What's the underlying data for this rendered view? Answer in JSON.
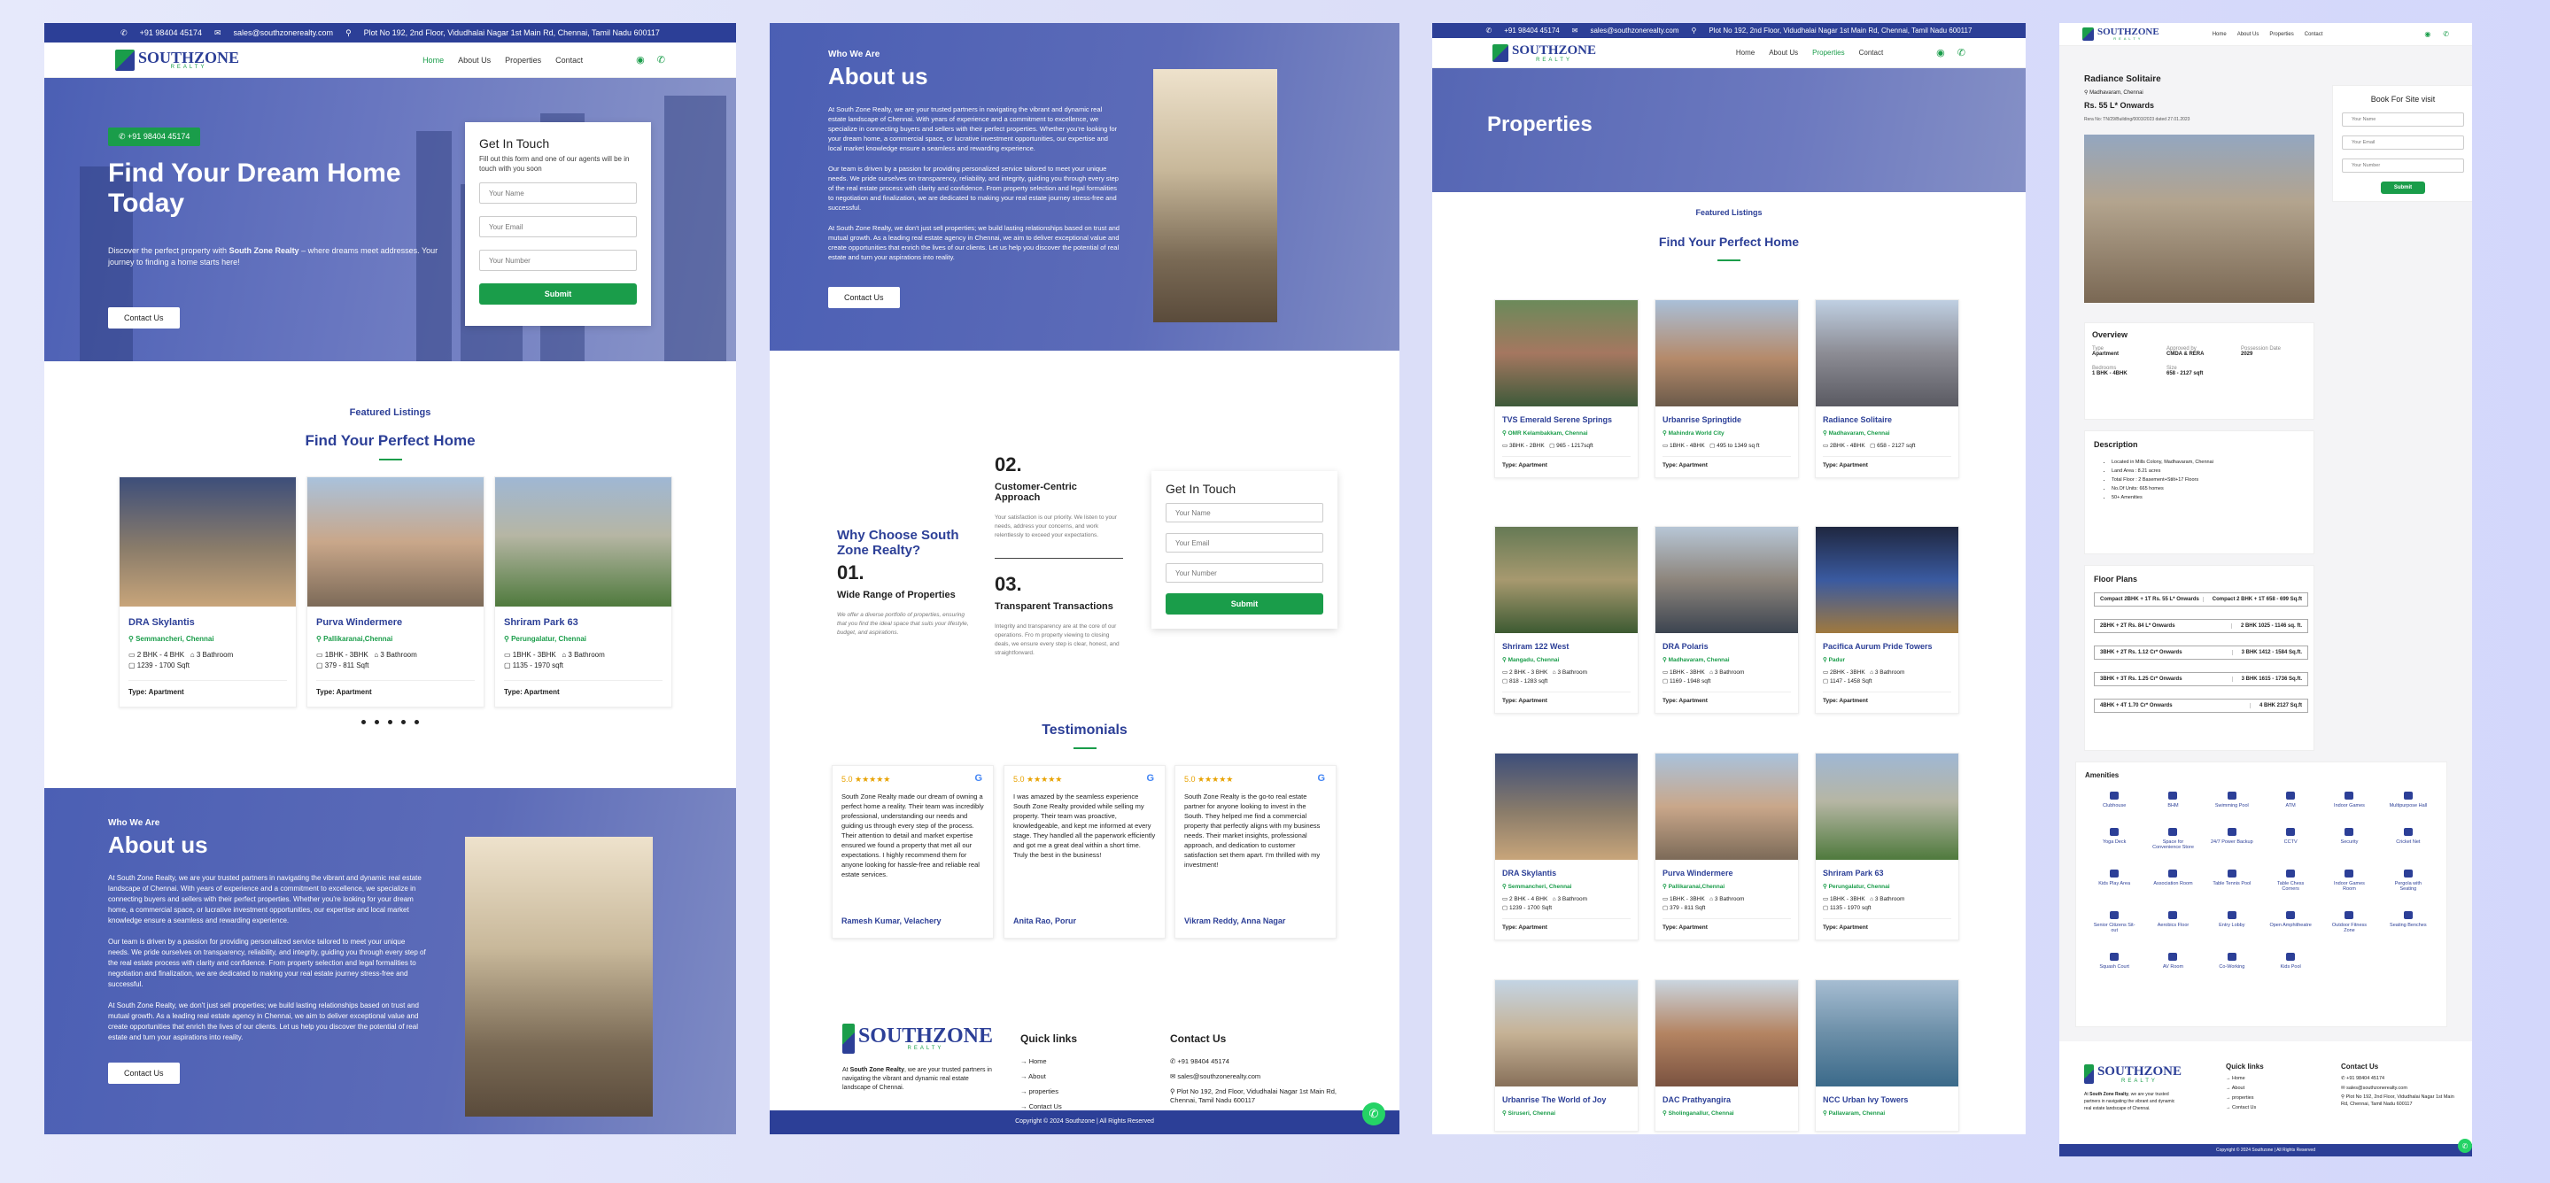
{
  "contact": {
    "phone": "+91 98404 45174",
    "email": "sales@southzonerealty.com",
    "address": "Plot No 192, 2nd Floor, Vidudhalai Nagar 1st Main Rd, Chennai, Tamil Nadu 600117"
  },
  "brand": {
    "name": "SOUTHZONE",
    "sub": "REALTY"
  },
  "nav": {
    "home": "Home",
    "about": "About Us",
    "properties": "Properties",
    "contact": "Contact"
  },
  "hero": {
    "phone_pill": "+91 98404 45174",
    "title": "Find Your Dream Home Today",
    "desc_pre": "Discover the perfect property with ",
    "desc_brand": "South Zone Realty",
    "desc_post": " – where dreams meet addresses. Your journey to finding a home starts here!",
    "cta": "Contact Us"
  },
  "form": {
    "title": "Get In Touch",
    "desc": "Fill out this form and one of our agents will be in touch with you soon",
    "name_ph": "Your Name",
    "email_ph": "Your Email",
    "number_ph": "Your Number",
    "submit": "Submit"
  },
  "featured": {
    "small": "Featured Listings",
    "big": "Find Your Perfect Home"
  },
  "slider": [
    {
      "title": "DRA Skylantis",
      "loc": "Semmancheri, Chennai",
      "bhk": "2 BHK - 4 BHK",
      "bath": "3 Bathroom",
      "size": "1239 - 1700 Sqft",
      "type": "Type: Apartment"
    },
    {
      "title": "Purva Windermere",
      "loc": "Pallikaranai,Chennai",
      "bhk": "1BHK - 3BHK",
      "bath": "3 Bathroom",
      "size": "379 - 811 Sqft",
      "type": "Type: Apartment"
    },
    {
      "title": "Shriram Park 63",
      "loc": "Perungalatur, Chennai",
      "bhk": "1BHK - 3BHK",
      "bath": "3 Bathroom",
      "size": "1135 - 1970 sqft",
      "type": "Type: Apartment"
    }
  ],
  "about": {
    "who": "Who We Are",
    "title": "About us",
    "p1": "At South Zone Realty, we are your trusted partners in navigating the vibrant and dynamic real estate landscape of Chennai. With years of experience and a commitment to excellence, we specialize in connecting buyers and sellers with their perfect properties. Whether you're looking for your dream home, a commercial space, or lucrative investment opportunities, our expertise and local market knowledge ensure a seamless and rewarding experience.",
    "p2": "Our team is driven by a passion for providing personalized service tailored to meet your unique needs. We pride ourselves on transparency, reliability, and integrity, guiding you through every step of the real estate process with clarity and confidence. From property selection and legal formalities to negotiation and finalization, we are dedicated to making your real estate journey stress-free and successful.",
    "p3": "At South Zone Realty, we don't just sell properties; we build lasting relationships based on trust and mutual growth. As a leading real estate agency in Chennai, we aim to deliver exceptional value and create opportunities that enrich the lives of our clients. Let us help you discover the potential of real estate and turn your aspirations into reality.",
    "cta": "Contact Us"
  },
  "why": {
    "title": "Why Choose South Zone Realty?",
    "n1": "01.",
    "h1": "Wide Range of Properties",
    "d1": "We offer a diverse portfolio of properties, ensuring that you find the ideal space that suits your lifestyle, budget, and aspirations.",
    "n2": "02.",
    "h2": "Customer-Centric Approach",
    "d2": "Your satisfaction is our priority. We listen to your needs, address your concerns, and work relentlessly to exceed your expectations.",
    "n3": "03.",
    "h3": "Transparent Transactions",
    "d3": "Integrity and transparency are at the core of our operations. Fro m property viewing to closing deals, we ensure every step is clear, honest, and straightforward."
  },
  "testimonials": {
    "title": "Testimonials",
    "items": [
      {
        "rating": "5.0 ★★★★★",
        "quote": "South Zone Realty made our dream of owning a perfect home a reality. Their team was incredibly professional, understanding our needs and guiding us through every step of the process. Their attention to detail and market expertise ensured we found a property that met all our expectations. I highly recommend them for anyone looking for hassle-free and reliable real estate services.",
        "name": "Ramesh Kumar, Velachery"
      },
      {
        "rating": "5.0 ★★★★★",
        "quote": "I was amazed by the seamless experience South Zone Realty provided while selling my property. Their team was proactive, knowledgeable, and kept me informed at every stage. They handled all the paperwork efficiently and got me a great deal within a short time. Truly the best in the business!",
        "name": "Anita Rao, Porur"
      },
      {
        "rating": "5.0 ★★★★★",
        "quote": "South Zone Realty is the go-to real estate partner for anyone looking to invest in the South. They helped me find a commercial property that perfectly aligns with my business needs. Their market insights, professional approach, and dedication to customer satisfaction set them apart. I'm thrilled with my investment!",
        "name": "Vikram Reddy, Anna Nagar"
      }
    ]
  },
  "footer": {
    "desc_pre": "At ",
    "desc_brand": "South Zone Realty",
    "desc_post": ", we are your trusted partners in navigating the vibrant and dynamic real estate landscape of Chennai.",
    "quick_title": "Quick links",
    "links": [
      "Home",
      "About",
      "properties",
      "Contact Us"
    ],
    "contact_title": "Contact Us",
    "copyright": "Copyright © 2024 Southzone | All Rights Reserved"
  },
  "properties_page": {
    "title": "Properties",
    "grid": [
      {
        "title": "TVS Emerald Serene Springs",
        "loc": "OMR Kelambakkam, Chennai",
        "bhk": "3BHK - 2BHK",
        "bath": "",
        "size": "965 - 1217sqft",
        "type": "Type: Apartment"
      },
      {
        "title": "Urbanrise Springtide",
        "loc": "Mahindra World City",
        "bhk": "1BHK - 4BHK",
        "bath": "",
        "size": "495 to 1349 sq ft",
        "type": "Type: Apartment"
      },
      {
        "title": "Radiance Solitaire",
        "loc": "Madhavaram, Chennai",
        "bhk": "2BHK - 4BHK",
        "bath": "",
        "size": "658 - 2127 sqft",
        "type": "Type: Apartment"
      },
      {
        "title": "Shriram 122 West",
        "loc": "Mangadu, Chennai",
        "bhk": "2 BHK - 3 BHK",
        "bath": "3 Bathroom",
        "size": "818 - 1283 sqft",
        "type": "Type: Apartment"
      },
      {
        "title": "DRA Polaris",
        "loc": "Madhavaram, Chennai",
        "bhk": "1BHK - 3BHK",
        "bath": "3 Bathroom",
        "size": "1169 - 1948 sqft",
        "type": "Type: Apartment"
      },
      {
        "title": "Pacifica Aurum Pride Towers",
        "loc": "Padur",
        "bhk": "2BHK - 3BHK",
        "bath": "3 Bathroom",
        "size": "1147 - 1458 Sqft",
        "type": "Type: Apartment"
      },
      {
        "title": "DRA Skylantis",
        "loc": "Semmancheri, Chennai",
        "bhk": "2 BHK - 4 BHK",
        "bath": "3 Bathroom",
        "size": "1239 - 1700 Sqft",
        "type": "Type: Apartment"
      },
      {
        "title": "Purva Windermere",
        "loc": "Pallikaranai,Chennai",
        "bhk": "1BHK - 3BHK",
        "bath": "3 Bathroom",
        "size": "379 - 811 Sqft",
        "type": "Type: Apartment"
      },
      {
        "title": "Shriram Park 63",
        "loc": "Perungalatur, Chennai",
        "bhk": "1BHK - 3BHK",
        "bath": "3 Bathroom",
        "size": "1135 - 1970 sqft",
        "type": "Type: Apartment"
      },
      {
        "title": "Urbanrise The World of Joy",
        "loc": "Siruseri, Chennai",
        "bhk": "",
        "bath": "",
        "size": "",
        "type": ""
      },
      {
        "title": "DAC Prathyangira",
        "loc": "Sholinganallur, Chennai",
        "bhk": "",
        "bath": "",
        "size": "",
        "type": ""
      },
      {
        "title": "NCC Urban Ivy Towers",
        "loc": "Pallavaram, Chennai",
        "bhk": "",
        "bath": "",
        "size": "",
        "type": ""
      }
    ]
  },
  "detail": {
    "title": "Radiance Solitaire",
    "loc": "Madhavaram, Chennai",
    "price": "Rs. 55 L* Onwards",
    "rera": "Rera No: TN/29/Building/0003/2023 dated 27.01.2023",
    "book_title": "Book For Site visit",
    "overview_title": "Overview",
    "overview": [
      {
        "label": "Type",
        "value": "Apartment"
      },
      {
        "label": "Approved by",
        "value": "CMDA & RERA"
      },
      {
        "label": "Possession Date",
        "value": "2029"
      },
      {
        "label": "Bedrooms",
        "value": "1 BHK - 4BHK"
      },
      {
        "label": "Size",
        "value": "658 - 2127 sqft"
      }
    ],
    "desc_title": "Description",
    "desc_items": [
      "Located in Mills Colony, Madhavaram, Chennai",
      "Land Area : 8.21 acres",
      "Total Floor : 2 Basement+Stilt+17 Floors",
      "No.Of Units: 665 homes",
      "50+ Amenities"
    ],
    "floor_title": "Floor Plans",
    "floor_rows": [
      {
        "a": "Compact 2BHK + 1T Rs. 55 L* Onwards",
        "b": "Compact 2 BHK + 1T 658 - 699 Sq.ft"
      },
      {
        "a": "2BHK + 2T  Rs. 84 L* Onwards",
        "b": "2 BHK  1025 - 1146 sq. ft."
      },
      {
        "a": "3BHK + 2T Rs. 1.12 Cr* Onwards",
        "b": "3 BHK  1412 - 1584 Sq.ft."
      },
      {
        "a": "3BHK + 3T Rs. 1.25 Cr* Onwards",
        "b": "3 BHK  1615 - 1736 Sq.ft."
      },
      {
        "a": "4BHK + 4T  1.70 Cr* Onwards",
        "b": "4 BHK  2127 Sq.ft"
      }
    ],
    "amen_title": "Amenities",
    "amenities": [
      "Clubhouse",
      "BHM",
      "Swimming Pool",
      "ATM",
      "Indoor Games",
      "Multipurpose Hall",
      "Yoga Deck",
      "Space for Convenience Store",
      "24/7 Power Backup",
      "CCTV",
      "Security",
      "Cricket Net",
      "Kids Play Area",
      "Association Room",
      "Table Tennis Pool",
      "Table Chess Corners",
      "Indoor Games Room",
      "Pergola with Seating",
      "Senior Citizens Sit-out",
      "Aerobics Floor",
      "Entry Lobby",
      "Open Amphitheatre",
      "Outdoor Fitness Zone",
      "Seating Benches",
      "Squash Court",
      "AV Room",
      "Co-Working",
      "Kids Pool"
    ]
  }
}
